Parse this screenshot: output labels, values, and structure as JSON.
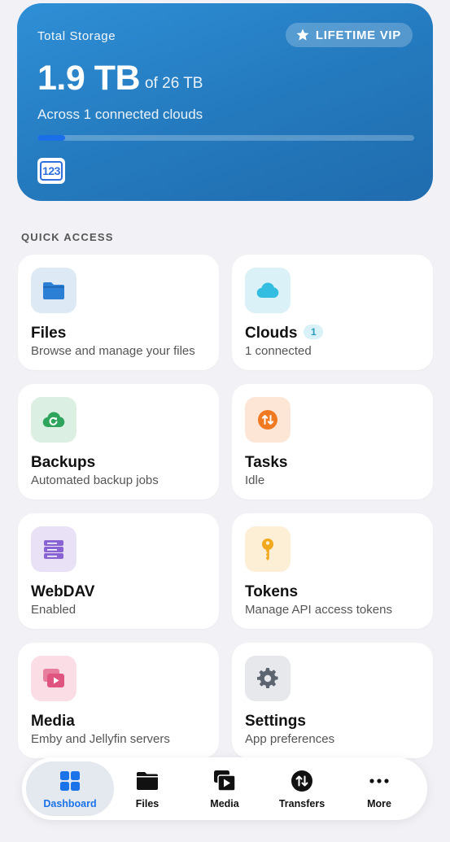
{
  "storage": {
    "title": "Total Storage",
    "vip_label": "LIFETIME VIP",
    "used": "1.9 TB",
    "total": "of 26 TB",
    "subtitle": "Across 1 connected clouds",
    "progress_fraction": 0.073,
    "cloud_logo_text": "123"
  },
  "section_label": "QUICK ACCESS",
  "tiles": {
    "files": {
      "title": "Files",
      "subtitle": "Browse and manage your files",
      "icon": "folder-icon"
    },
    "clouds": {
      "title": "Clouds",
      "badge": "1",
      "subtitle": "1 connected",
      "icon": "cloud-icon"
    },
    "backups": {
      "title": "Backups",
      "subtitle": "Automated backup jobs",
      "icon": "cloud-sync-icon"
    },
    "tasks": {
      "title": "Tasks",
      "subtitle": "Idle",
      "icon": "transfer-arrows-icon"
    },
    "webdav": {
      "title": "WebDAV",
      "subtitle": "Enabled",
      "icon": "server-icon"
    },
    "tokens": {
      "title": "Tokens",
      "subtitle": "Manage API access tokens",
      "icon": "key-icon"
    },
    "media": {
      "title": "Media",
      "subtitle": "Emby and Jellyfin servers",
      "icon": "media-play-icon"
    },
    "settings": {
      "title": "Settings",
      "subtitle": "App preferences",
      "icon": "gear-icon"
    }
  },
  "tabbar": {
    "dashboard": "Dashboard",
    "files": "Files",
    "media": "Media",
    "transfers": "Transfers",
    "more": "More"
  },
  "colors": {
    "accent": "#1a73e8",
    "storage_card": "#2479bd",
    "files_icon": "#2b7fd4",
    "clouds_icon": "#33bde0",
    "backups_icon": "#2ea45c",
    "tasks_icon": "#f07a22",
    "webdav_icon": "#8a63d2",
    "tokens_icon": "#f2a81d",
    "media_icon": "#e0557f",
    "settings_icon": "#5c6470"
  }
}
